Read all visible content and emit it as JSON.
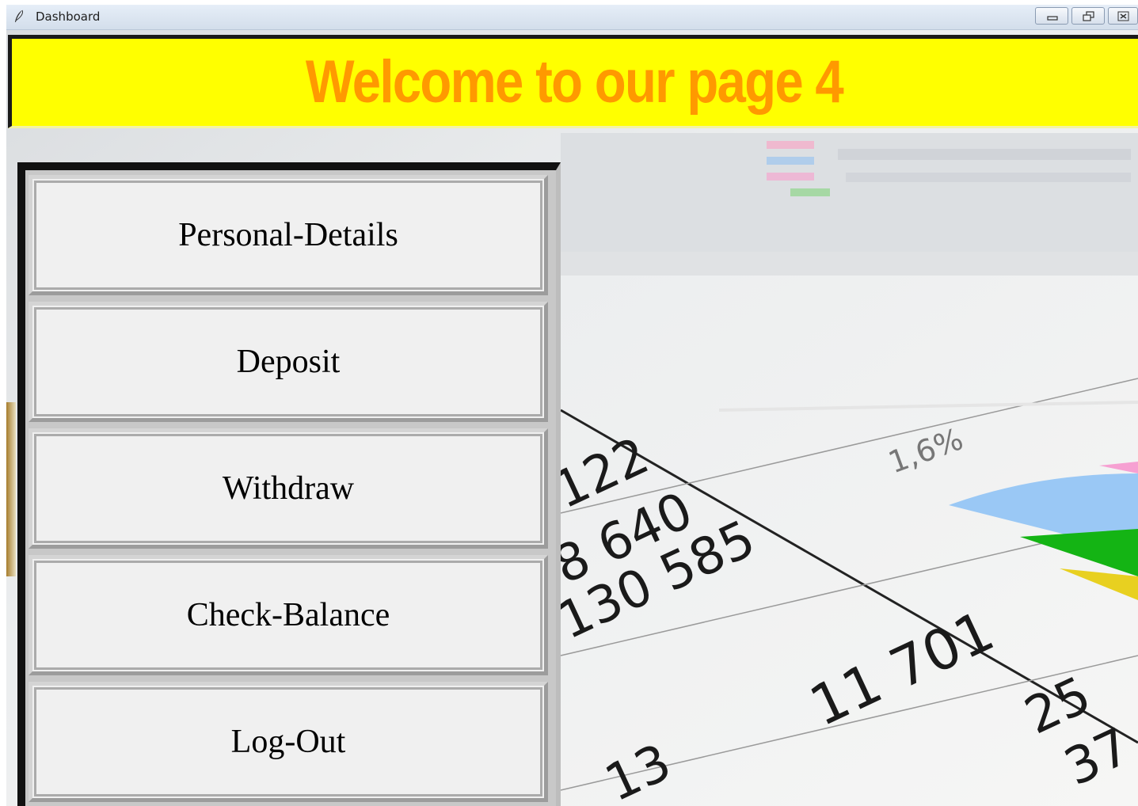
{
  "window": {
    "title": "Dashboard",
    "controls": {
      "minimize_icon": "minimize-icon",
      "restore_icon": "restore-icon",
      "close_icon": "close-icon"
    }
  },
  "header": {
    "title": "Welcome to our page 4",
    "background_color": "#ffff00",
    "text_color": "#ff9900"
  },
  "menu": {
    "items": [
      {
        "label": "Personal-Details"
      },
      {
        "label": "Deposit"
      },
      {
        "label": "Withdraw"
      },
      {
        "label": "Check-Balance"
      },
      {
        "label": "Log-Out"
      }
    ]
  },
  "background": {
    "numbers": [
      "122",
      "8 640",
      "130 585",
      "11 701",
      "25",
      "37",
      "13",
      "1,6%"
    ]
  }
}
